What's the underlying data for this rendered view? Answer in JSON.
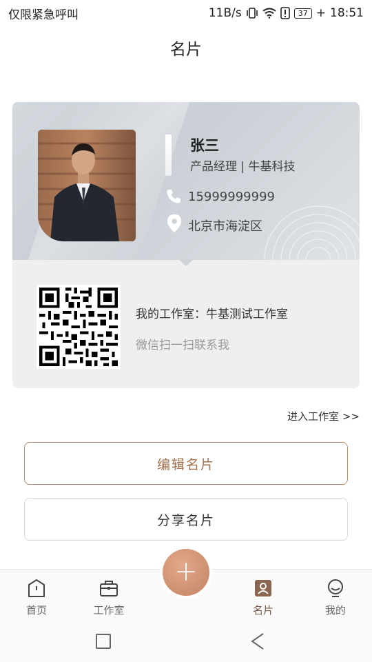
{
  "status_bar": {
    "carrier": "仅限紧急呼叫",
    "speed": "11B/s",
    "battery": "37",
    "time": "18:51"
  },
  "page": {
    "title": "名片"
  },
  "card": {
    "name": "张三",
    "position": "产品经理 | 牛基科技",
    "phone": "15999999999",
    "address": "北京市海淀区",
    "studio_label": "我的工作室：牛基测试工作室",
    "scan_hint": "微信扫一扫联系我"
  },
  "links": {
    "enter_studio": "进入工作室 >>"
  },
  "buttons": {
    "edit": "编辑名片",
    "share": "分享名片"
  },
  "tabbar": {
    "home": "首页",
    "studio": "工作室",
    "card": "名片",
    "me": "我的",
    "fab_symbol": "+"
  },
  "colors": {
    "accent": "#a3714e",
    "fab": "#d49777",
    "card_top": "#cfd4d9"
  }
}
